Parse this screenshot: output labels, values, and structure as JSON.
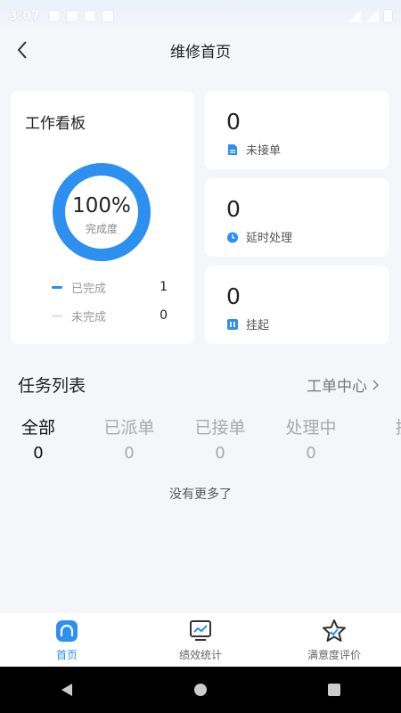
{
  "status_bar": {
    "time": "3:07"
  },
  "header": {
    "title": "维修首页",
    "back_icon": "chevron-left-icon"
  },
  "board": {
    "title": "工作看板",
    "progress": {
      "value_text": "100%",
      "label": "完成度",
      "fraction": 1.0
    },
    "legend": [
      {
        "label": "已完成",
        "count": "1",
        "color": "#2d8ff0"
      },
      {
        "label": "未完成",
        "count": "0",
        "color": "#e6e6e6"
      }
    ]
  },
  "stats": [
    {
      "value": "0",
      "label": "未接单",
      "icon": "document-icon"
    },
    {
      "value": "0",
      "label": "延时处理",
      "icon": "clock-icon"
    },
    {
      "value": "0",
      "label": "挂起",
      "icon": "pause-doc-icon"
    }
  ],
  "tasks": {
    "title": "任务列表",
    "center_link": "工单中心",
    "tabs": [
      {
        "label": "全部",
        "count": "0",
        "active": true
      },
      {
        "label": "已派单",
        "count": "0"
      },
      {
        "label": "已接单",
        "count": "0"
      },
      {
        "label": "处理中",
        "count": "0"
      },
      {
        "label": "挂",
        "count": ""
      }
    ],
    "empty_text": "没有更多了"
  },
  "bottom_nav": [
    {
      "label": "首页",
      "icon": "home-icon",
      "active": true
    },
    {
      "label": "绩效统计",
      "icon": "chart-monitor-icon"
    },
    {
      "label": "满意度评价",
      "icon": "star-check-icon"
    }
  ],
  "colors": {
    "accent": "#2d8ff0",
    "background": "#f4f6fa"
  }
}
